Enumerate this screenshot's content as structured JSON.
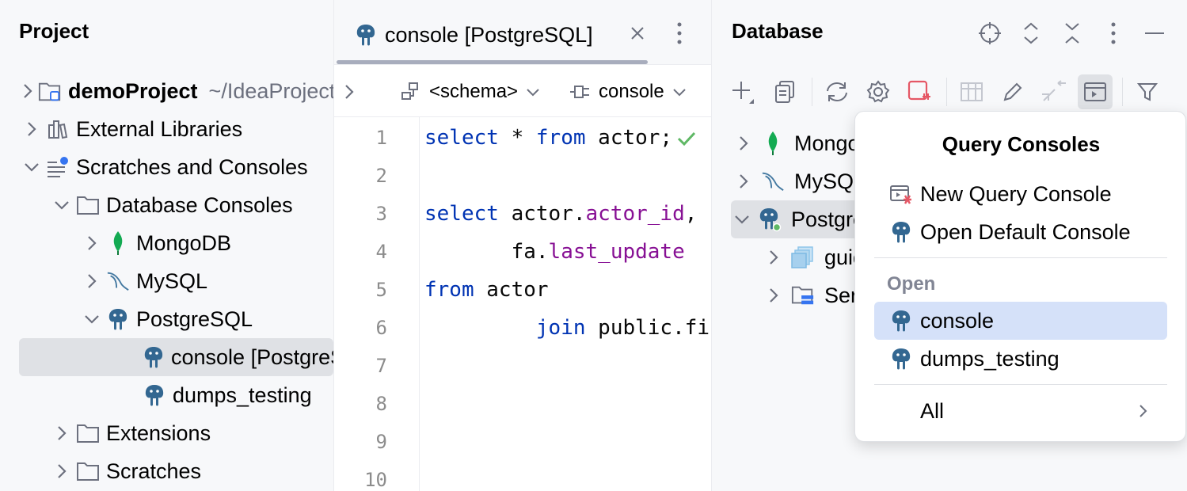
{
  "project": {
    "title": "Project",
    "tree": [
      {
        "label": "demoProject",
        "path": "~/IdeaProjects"
      },
      {
        "label": "External Libraries"
      },
      {
        "label": "Scratches and Consoles"
      },
      {
        "label": "Database Consoles"
      },
      {
        "label": "MongoDB"
      },
      {
        "label": "MySQL"
      },
      {
        "label": "PostgreSQL"
      },
      {
        "label": "console [PostgreSQL]"
      },
      {
        "label": "dumps_testing"
      },
      {
        "label": "Extensions"
      },
      {
        "label": "Scratches"
      }
    ]
  },
  "editor": {
    "tab_label": "console [PostgreSQL]",
    "schema_label": "<schema>",
    "console_label": "console",
    "line_numbers": [
      "1",
      "2",
      "3",
      "4",
      "5",
      "6",
      "7",
      "8",
      "9",
      "10"
    ],
    "code": {
      "l1_kw1": "select",
      "l1_mid": " * ",
      "l1_kw2": "from",
      "l1_rest": " actor;",
      "l3_kw": "select",
      "l3_obj": " actor.",
      "l3_fld": "actor_id",
      "l3_rest": ",",
      "l4_obj": "       fa.",
      "l4_fld": "last_update",
      "l5_kw": "from",
      "l5_rest": " actor",
      "l6_pad": "         ",
      "l6_kw": "join",
      "l6_rest": " public.film_actor fa"
    }
  },
  "database": {
    "title": "Database",
    "tree": [
      {
        "label": "MongoDB"
      },
      {
        "label": "MySQL"
      },
      {
        "label": "PostgreSQL"
      },
      {
        "label": "guides"
      },
      {
        "label": "Server Objects"
      }
    ]
  },
  "popup": {
    "title": "Query Consoles",
    "new_console": "New Query Console",
    "default_console": "Open Default Console",
    "open_label": "Open",
    "consoles": [
      "console",
      "dumps_testing"
    ],
    "all_label": "All"
  },
  "colors": {
    "keyword": "#0033b3",
    "field": "#871094",
    "selection": "#d5e1f9",
    "postgres_blue": "#336791",
    "mongo_green": "#13aa52"
  }
}
